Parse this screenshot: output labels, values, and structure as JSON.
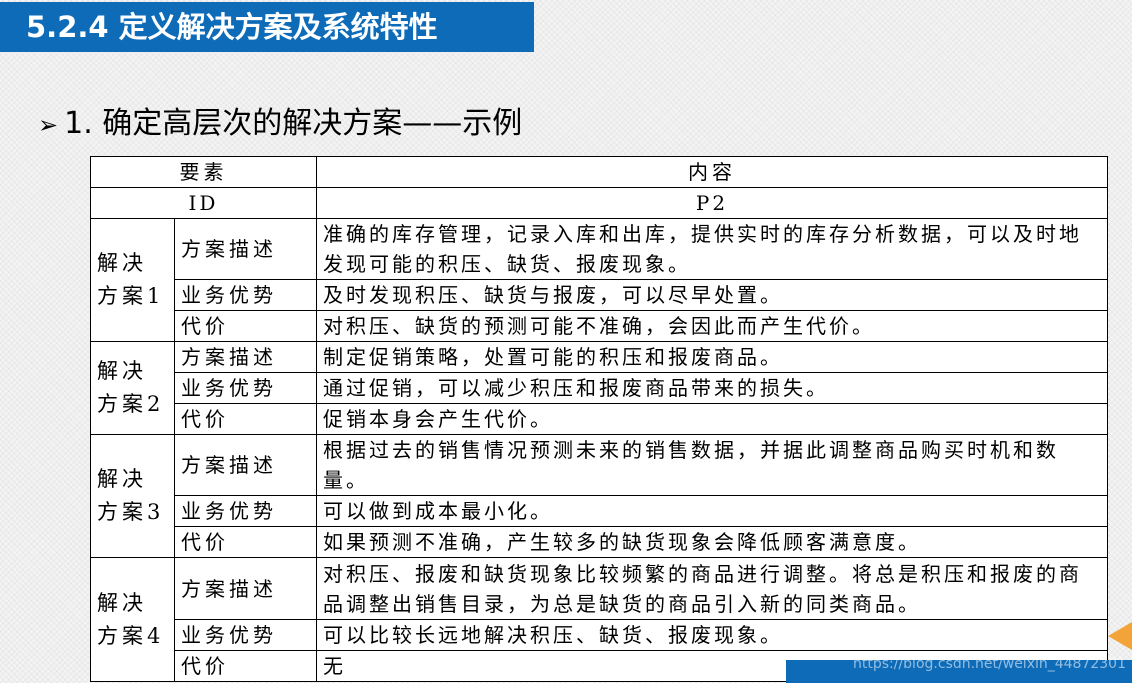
{
  "title": "5.2.4 定义解决方案及系统特性",
  "heading": {
    "bullet": "➢",
    "text": "1. 确定高层次的解决方案——示例"
  },
  "table": {
    "header": [
      "要素",
      "内容"
    ],
    "id_row": [
      "ID",
      "P2"
    ],
    "groups": [
      {
        "name": "解决方案1",
        "rows": [
          {
            "attr": "方案描述",
            "text": "准确的库存管理，记录入库和出库，提供实时的库存分析数据，可以及时地发现可能的积压、缺货、报废现象。"
          },
          {
            "attr": "业务优势",
            "text": "及时发现积压、缺货与报废，可以尽早处置。"
          },
          {
            "attr": "代价",
            "text": "对积压、缺货的预测可能不准确，会因此而产生代价。"
          }
        ]
      },
      {
        "name": "解决方案2",
        "rows": [
          {
            "attr": "方案描述",
            "text": "制定促销策略，处置可能的积压和报废商品。"
          },
          {
            "attr": "业务优势",
            "text": "通过促销，可以减少积压和报废商品带来的损失。"
          },
          {
            "attr": "代价",
            "text": "促销本身会产生代价。"
          }
        ]
      },
      {
        "name": "解决方案3",
        "rows": [
          {
            "attr": "方案描述",
            "text": "根据过去的销售情况预测未来的销售数据，并据此调整商品购买时机和数量。"
          },
          {
            "attr": "业务优势",
            "text": "可以做到成本最小化。"
          },
          {
            "attr": "代价",
            "text": "如果预测不准确，产生较多的缺货现象会降低顾客满意度。"
          }
        ]
      },
      {
        "name": "解决方案4",
        "rows": [
          {
            "attr": "方案描述",
            "text": "对积压、报废和缺货现象比较频繁的商品进行调整。将总是积压和报废的商品调整出销售目录，为总是缺货的商品引入新的同类商品。"
          },
          {
            "attr": "业务优势",
            "text": "可以比较长远地解决积压、缺货、报废现象。"
          },
          {
            "attr": "代价",
            "text": "无"
          }
        ]
      }
    ]
  },
  "watermark": "https://blog.csdn.net/weixin_44872301",
  "colors": {
    "title_bar": "#0d6bb8",
    "accent_arrow": "#f2a43a"
  }
}
